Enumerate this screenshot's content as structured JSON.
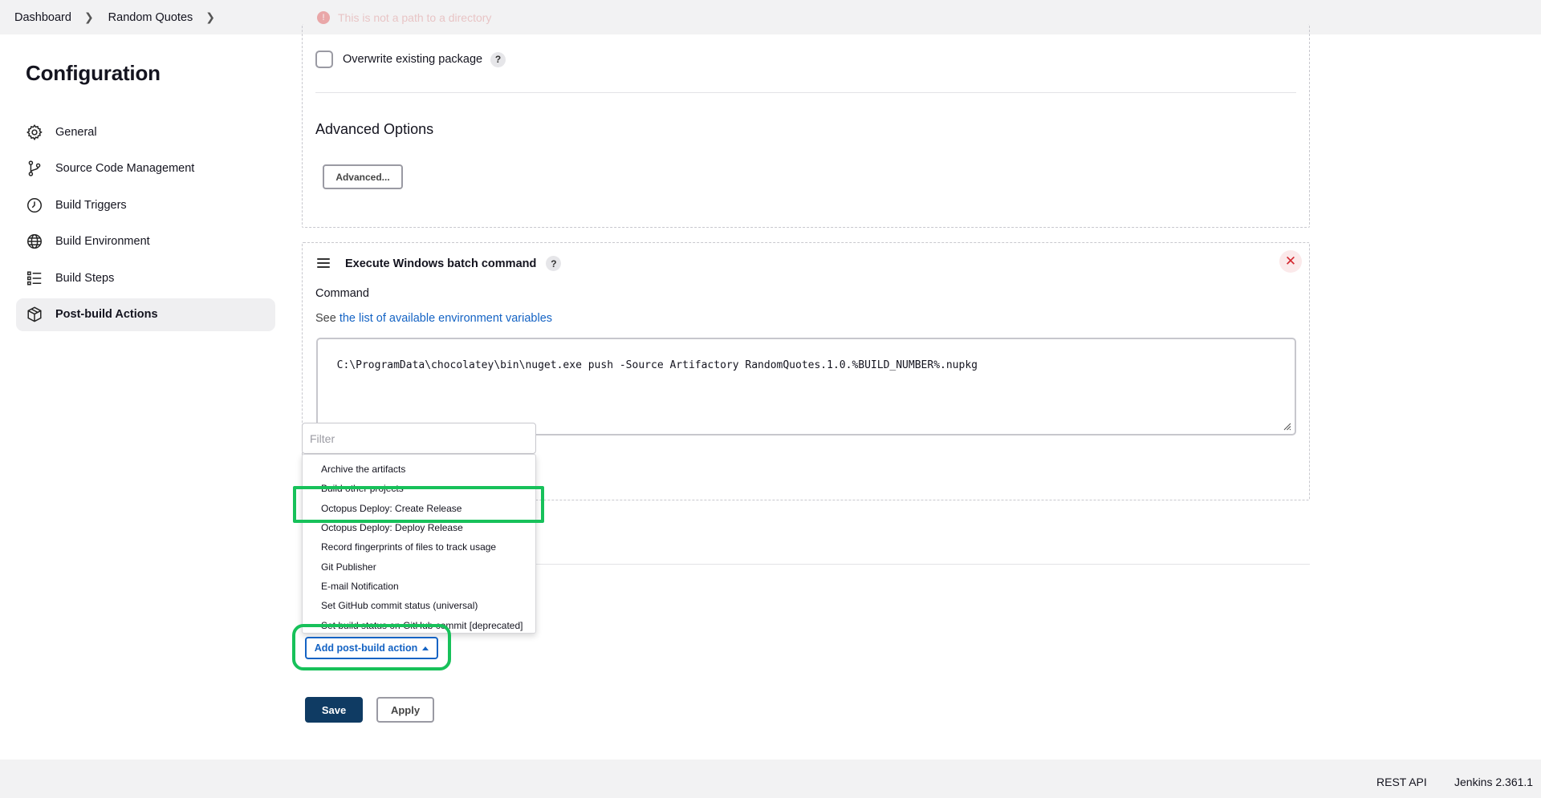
{
  "breadcrumb": {
    "items": [
      "Dashboard",
      "Random Quotes"
    ]
  },
  "background_warning": "This is not a path to a directory",
  "sidebar": {
    "title": "Configuration",
    "items": [
      {
        "label": "General",
        "icon": "gear-icon"
      },
      {
        "label": "Source Code Management",
        "icon": "branch-icon"
      },
      {
        "label": "Build Triggers",
        "icon": "timer-icon"
      },
      {
        "label": "Build Environment",
        "icon": "globe-icon"
      },
      {
        "label": "Build Steps",
        "icon": "list-icon"
      },
      {
        "label": "Post-build Actions",
        "icon": "package-icon",
        "active": true
      }
    ]
  },
  "publish_section": {
    "overwrite_label": "Overwrite existing package",
    "overwrite_checked": false,
    "help_glyph": "?",
    "advanced_title": "Advanced Options",
    "advanced_button": "Advanced..."
  },
  "batch_step": {
    "title": "Execute Windows batch command",
    "close_glyph": "✕",
    "command_label": "Command",
    "env_prefix": "See",
    "env_link": "the list of available environment variables",
    "command_value": "C:\\ProgramData\\chocolatey\\bin\\nuget.exe push -Source Artifactory RandomQuotes.1.0.%BUILD_NUMBER%.nupkg"
  },
  "dropdown": {
    "filter_placeholder": "Filter",
    "items": [
      "Archive the artifacts",
      "Build other projects",
      "Octopus Deploy: Create Release",
      "Octopus Deploy: Deploy Release",
      "Record fingerprints of files to track usage",
      "Git Publisher",
      "E-mail Notification",
      "Set GitHub commit status (universal)",
      "Set build status on GitHub commit [deprecated]"
    ],
    "highlighted_index": 2
  },
  "actions": {
    "add_post_build": "Add post-build action",
    "save": "Save",
    "apply": "Apply"
  },
  "footer": {
    "rest_api": "REST API",
    "version": "Jenkins 2.361.1"
  },
  "colors": {
    "accent": "#1463c4",
    "save_bg": "#0f3b63",
    "highlight": "#17c15a",
    "danger": "#d3272f"
  }
}
